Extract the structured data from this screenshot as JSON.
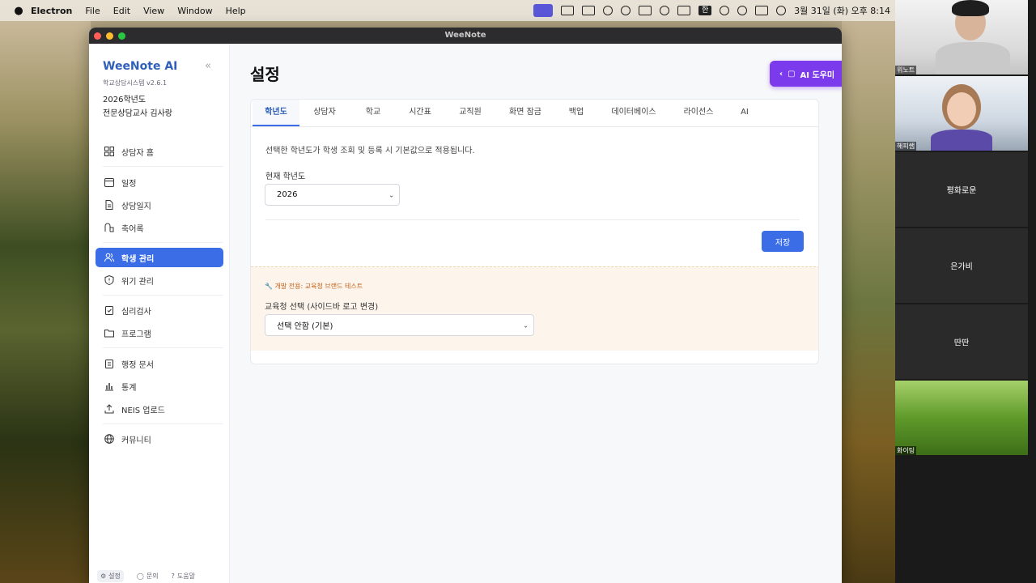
{
  "menubar": {
    "app_name": "Electron",
    "items": [
      "File",
      "Edit",
      "View",
      "Window",
      "Help"
    ],
    "status_han": "한",
    "datetime": "3월 31일 (화) 오후 8:14"
  },
  "window": {
    "title": "WeeNote"
  },
  "sidebar": {
    "brand": "WeeNote AI",
    "version": "학교상담시스템 v2.6.1",
    "year": "2026학년도",
    "teacher": "전문상담교사 김사랑",
    "collapse": "«",
    "items": [
      {
        "label": "상담자 홈",
        "icon": "grid-icon"
      },
      {
        "label": "일정",
        "icon": "calendar-icon"
      },
      {
        "label": "상담일지",
        "icon": "document-icon"
      },
      {
        "label": "축어록",
        "icon": "transcript-icon"
      },
      {
        "label": "학생 관리",
        "icon": "users-icon"
      },
      {
        "label": "위기 관리",
        "icon": "alert-icon"
      },
      {
        "label": "심리검사",
        "icon": "clipboard-check-icon"
      },
      {
        "label": "프로그램",
        "icon": "folder-icon"
      },
      {
        "label": "행정 문서",
        "icon": "clipboard-icon"
      },
      {
        "label": "통계",
        "icon": "bar-chart-icon"
      },
      {
        "label": "NEIS 업로드",
        "icon": "upload-icon"
      },
      {
        "label": "커뮤니티",
        "icon": "globe-icon"
      }
    ],
    "footer": {
      "settings": "설정",
      "inquiry": "문의",
      "help": "도움말"
    }
  },
  "main": {
    "title": "설정",
    "ai_button": "AI 도우미",
    "tabs": [
      "학년도",
      "상담자",
      "학교",
      "시간표",
      "교직원",
      "화면 잠금",
      "백업",
      "데이터베이스",
      "라이선스",
      "AI"
    ],
    "description": "선택한 학년도가 학생 조회 및 등록 시 기본값으로 적용됩니다.",
    "year_label": "현재 학년도",
    "year_value": "2026",
    "save": "저장",
    "dev_note": "🔧 개발 전용: 교육청 브랜드 테스트",
    "office_label": "교육청 선택 (사이드바 로고 변경)",
    "office_value": "선택 안함 (기본)"
  },
  "call": {
    "participants": [
      {
        "tag": "위노트"
      },
      {
        "tag": "해피쌤"
      },
      {
        "name": "평화로운"
      },
      {
        "name": "은가비"
      },
      {
        "name": "딴딴"
      },
      {
        "tag": "화이팅"
      }
    ]
  },
  "colors": {
    "accent": "#3b6ee6",
    "brand": "#2f5fb8",
    "ai": "#7c3aed",
    "dev_note": "#c2621a"
  }
}
